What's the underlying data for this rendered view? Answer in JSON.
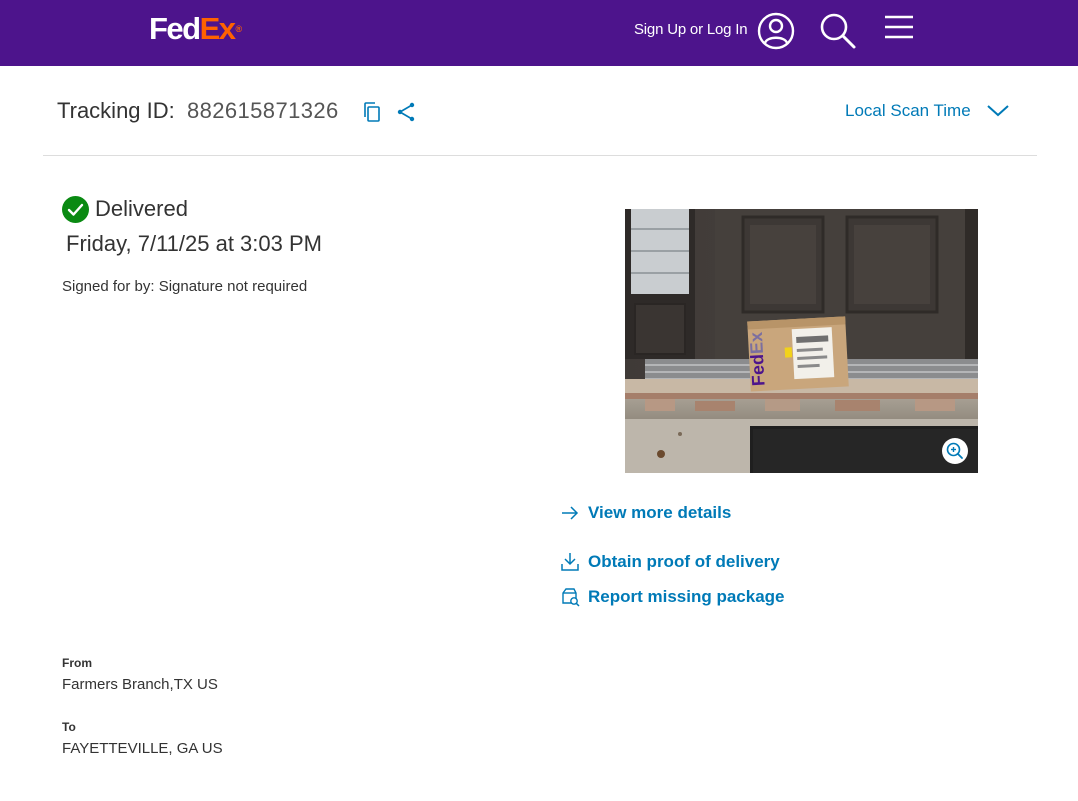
{
  "header": {
    "logo_fed": "Fed",
    "logo_ex": "Ex",
    "logo_reg": "®",
    "signin_label": "Sign Up or Log In",
    "brand_color": "#4d148c",
    "accent_color": "#ff6200",
    "icons": [
      "user-icon",
      "search-icon",
      "menu-icon"
    ]
  },
  "tracking": {
    "label": "Tracking ID:",
    "number": "882615871326",
    "icons": [
      "copy-icon",
      "share-icon"
    ],
    "scan_time_label": "Local Scan Time",
    "link_color": "#007ab7"
  },
  "status": {
    "state": "Delivered",
    "date": "Friday, 7/11/25 at 3:03 PM",
    "signed_for": "Signed for by: Signature not required",
    "status_color": "#0a8a12"
  },
  "photo": {
    "package_logo_fed": "Fed",
    "package_logo_ex": "Ex",
    "icon": "zoom-in-icon"
  },
  "actions": [
    {
      "label": "View more details",
      "icon": "arrow-right-icon"
    },
    {
      "label": "Obtain proof of delivery",
      "icon": "download-icon"
    },
    {
      "label": "Report missing package",
      "icon": "package-search-icon"
    }
  ],
  "route": {
    "from_label": "From",
    "from_value": "Farmers Branch,TX US",
    "to_label": "To",
    "to_value": "FAYETTEVILLE, GA US"
  }
}
